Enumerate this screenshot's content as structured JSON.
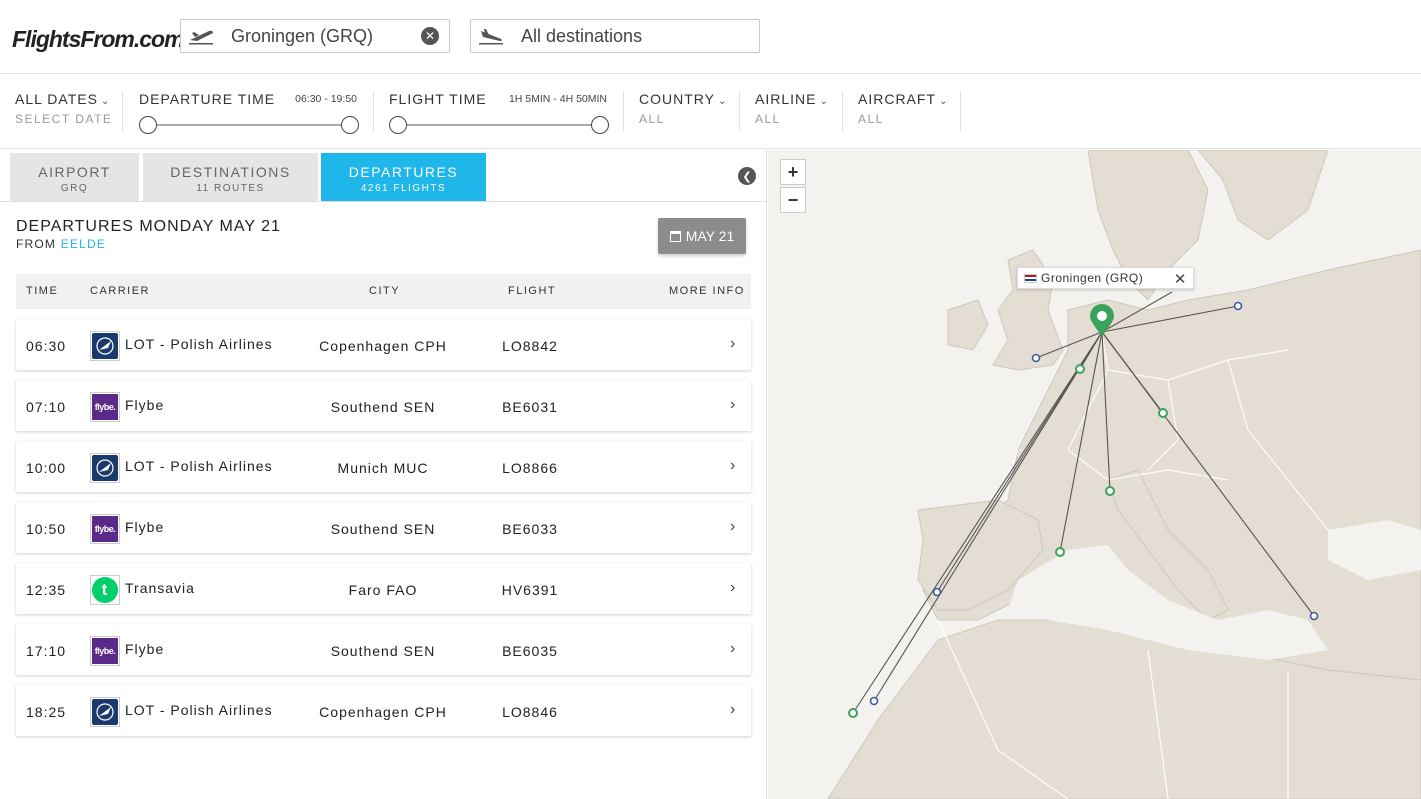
{
  "brand": {
    "logo_text": "FlightsFrom.com"
  },
  "search": {
    "from_value": "Groningen (GRQ)",
    "to_value": "All destinations",
    "from_icon": "takeoff-icon",
    "to_icon": "landing-icon"
  },
  "filters": {
    "dates": {
      "title": "ALL DATES",
      "sub": "SELECT DATE"
    },
    "departure_time": {
      "title": "DEPARTURE TIME",
      "range": "06:30 - 19:50"
    },
    "flight_time": {
      "title": "FLIGHT TIME",
      "range": "1H 5MIN - 4H 50MIN"
    },
    "country": {
      "title": "COUNTRY",
      "sub": "ALL"
    },
    "airline": {
      "title": "AIRLINE",
      "sub": "ALL"
    },
    "aircraft": {
      "title": "AIRCRAFT",
      "sub": "ALL"
    }
  },
  "tabs": [
    {
      "label": "AIRPORT",
      "sub": "GRQ"
    },
    {
      "label": "DESTINATIONS",
      "sub": "11 ROUTES"
    },
    {
      "label": "DEPARTURES",
      "sub": "4261 FLIGHTS"
    }
  ],
  "departures": {
    "title": "DEPARTURES MONDAY MAY 21",
    "from_prefix": "FROM",
    "from_link": "EELDE",
    "date_button": "MAY 21",
    "columns": {
      "time": "TIME",
      "carrier": "CARRIER",
      "city": "CITY",
      "flight": "FLIGHT",
      "more": "MORE INFO"
    },
    "rows": [
      {
        "time": "06:30",
        "carrier": "LOT - Polish Airlines",
        "city": "Copenhagen CPH",
        "flight": "LO8842"
      },
      {
        "time": "07:10",
        "carrier": "Flybe",
        "city": "Southend SEN",
        "flight": "BE6031"
      },
      {
        "time": "10:00",
        "carrier": "LOT - Polish Airlines",
        "city": "Munich MUC",
        "flight": "LO8866"
      },
      {
        "time": "10:50",
        "carrier": "Flybe",
        "city": "Southend SEN",
        "flight": "BE6033"
      },
      {
        "time": "12:35",
        "carrier": "Transavia",
        "city": "Faro FAO",
        "flight": "HV6391"
      },
      {
        "time": "17:10",
        "carrier": "Flybe",
        "city": "Southend SEN",
        "flight": "BE6035"
      },
      {
        "time": "18:25",
        "carrier": "LOT - Polish Airlines",
        "city": "Copenhagen CPH",
        "flight": "LO8846"
      }
    ]
  },
  "logos": {
    "flybe": "flybe.",
    "transavia": "t"
  },
  "map": {
    "zoom_in": "+",
    "zoom_out": "−",
    "popup_label": "Groningen (GRQ)",
    "popup_close": "✕"
  },
  "colors": {
    "accent": "#1fb6ea",
    "map_land": "#e4ddd3",
    "map_sea": "#f4f2ee",
    "pin_green": "#3aa35a",
    "pin_blue": "#3a5aa8"
  }
}
